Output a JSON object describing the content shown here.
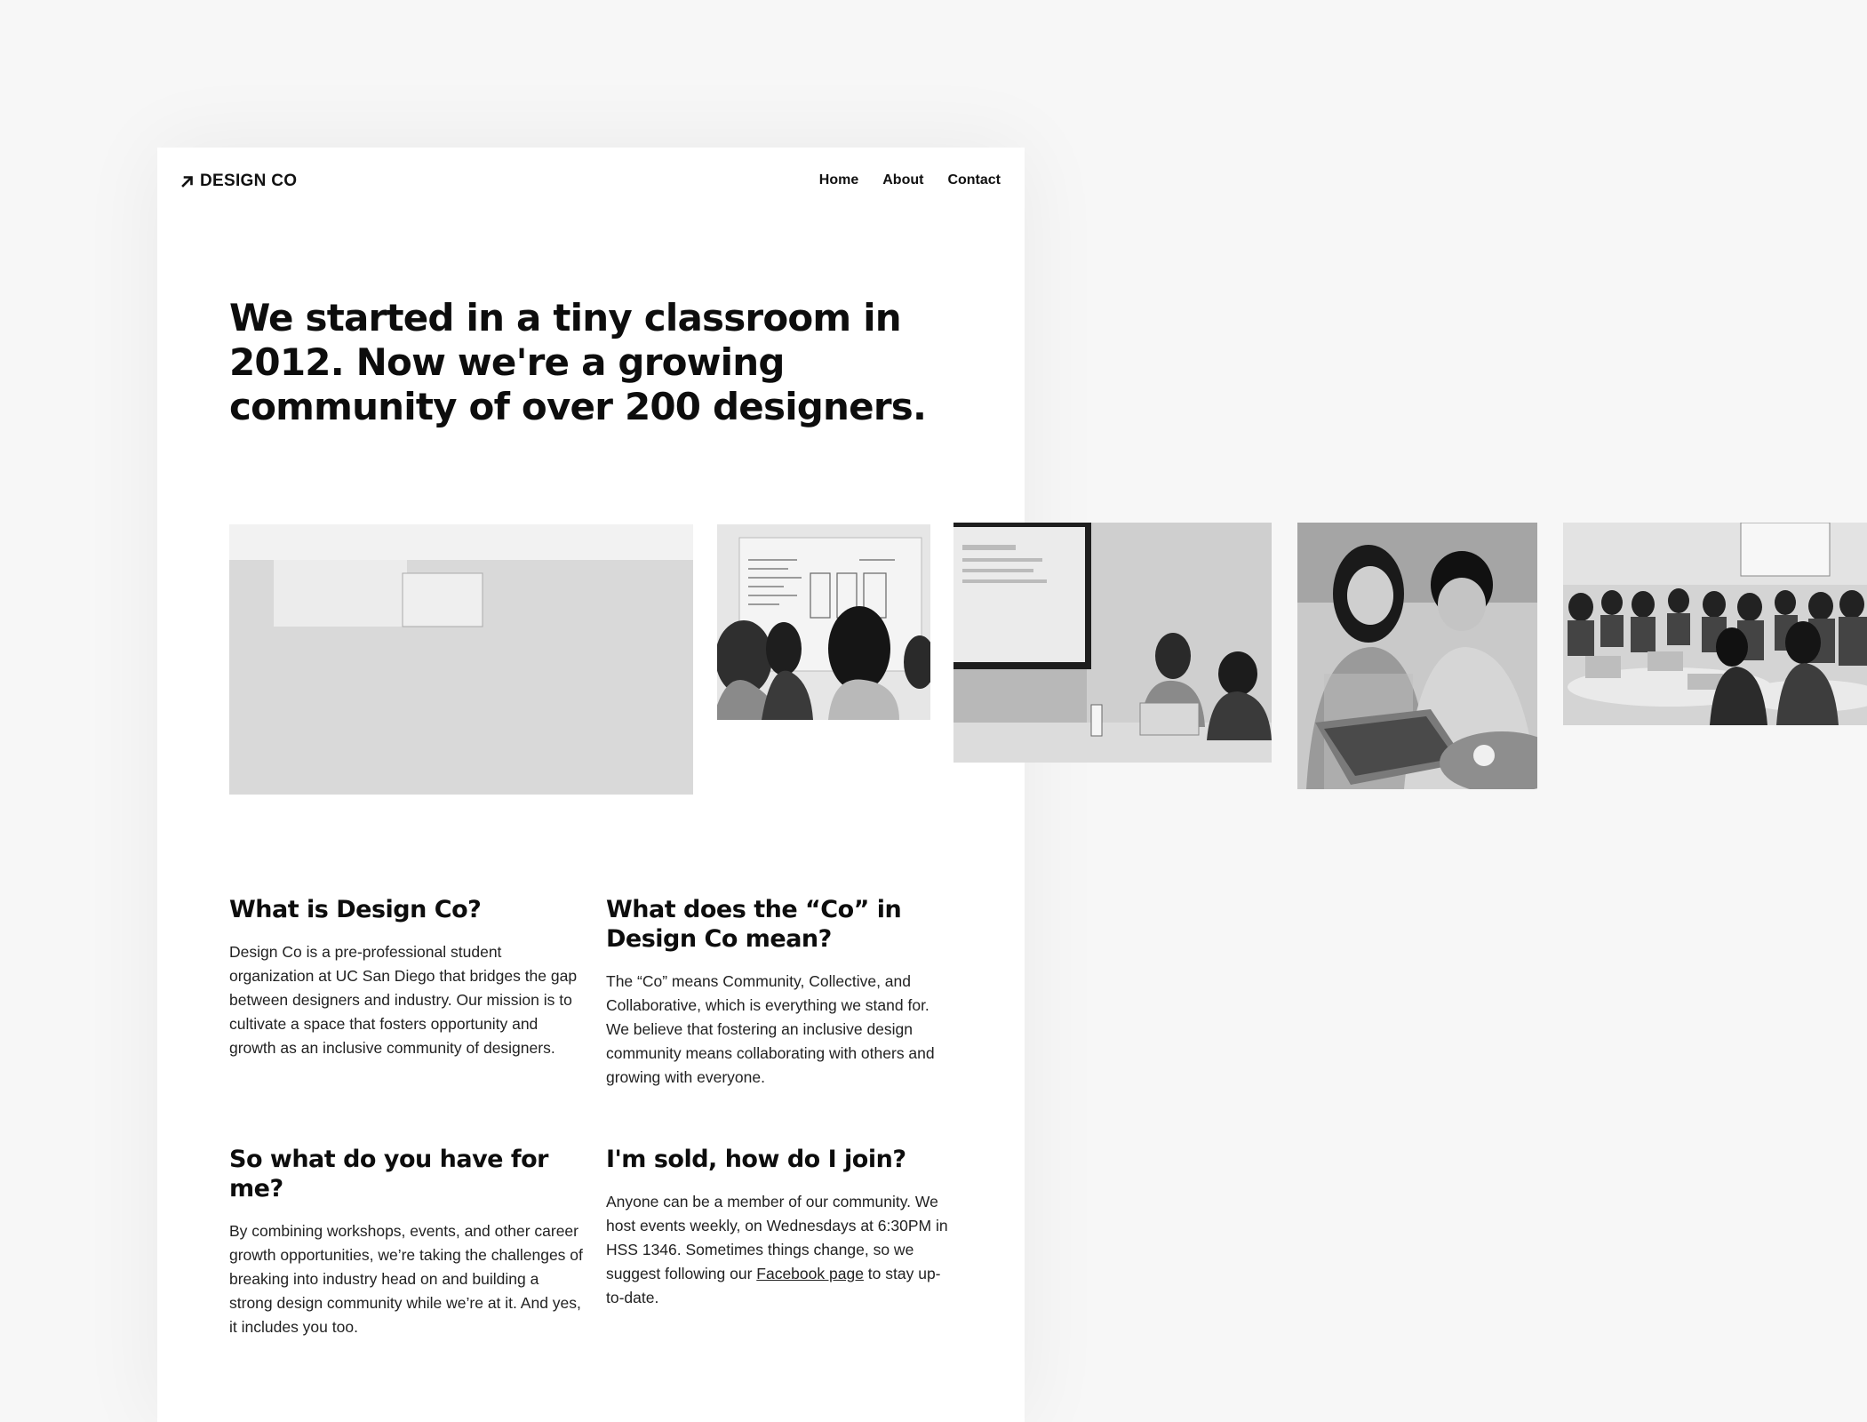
{
  "colors": {
    "page_bg": "#f7f7f7",
    "card_bg": "#ffffff",
    "text": "#111111"
  },
  "nav": {
    "logo_icon": "arrow-up-right-icon",
    "logo_text": "DESIGN CO",
    "links": [
      "Home",
      "About",
      "Contact"
    ]
  },
  "hero": {
    "title": "We started in a tiny classroom in 2012. Now we're a growing community of over 200 designers."
  },
  "photos": [
    "workshop-group-photo",
    "whiteboard-photo",
    "presentation-photo",
    "laptop-pair-photo",
    "lecture-hall-photo"
  ],
  "faq": [
    {
      "question": "What is Design Co?",
      "answer": "Design Co is a pre-professional student organization at UC San Diego that bridges the gap between designers and industry. Our mission is to cultivate a space that fosters opportunity and growth as an inclusive community of designers."
    },
    {
      "question": "What does the “Co” in Design Co mean?",
      "answer": "The “Co” means Community, Collective, and Collaborative, which is everything we stand for. We believe that fostering an inclusive design community means collaborating with others and growing with everyone."
    },
    {
      "question": "So what do you have for me?",
      "answer": "By combining workshops, events, and other career growth opportunities, we’re taking the challenges of breaking into industry head on and building a strong design community while we’re at it. And yes, it includes you too."
    },
    {
      "question": "I'm sold, how do I join?",
      "answer_before_link": "Anyone can be a member of our community. We host events weekly, on Wednesdays at 6:30PM in HSS 1346. Sometimes things change, so we suggest following our ",
      "link_text": "Facebook page",
      "answer_after_link": " to stay up-to-date."
    }
  ]
}
